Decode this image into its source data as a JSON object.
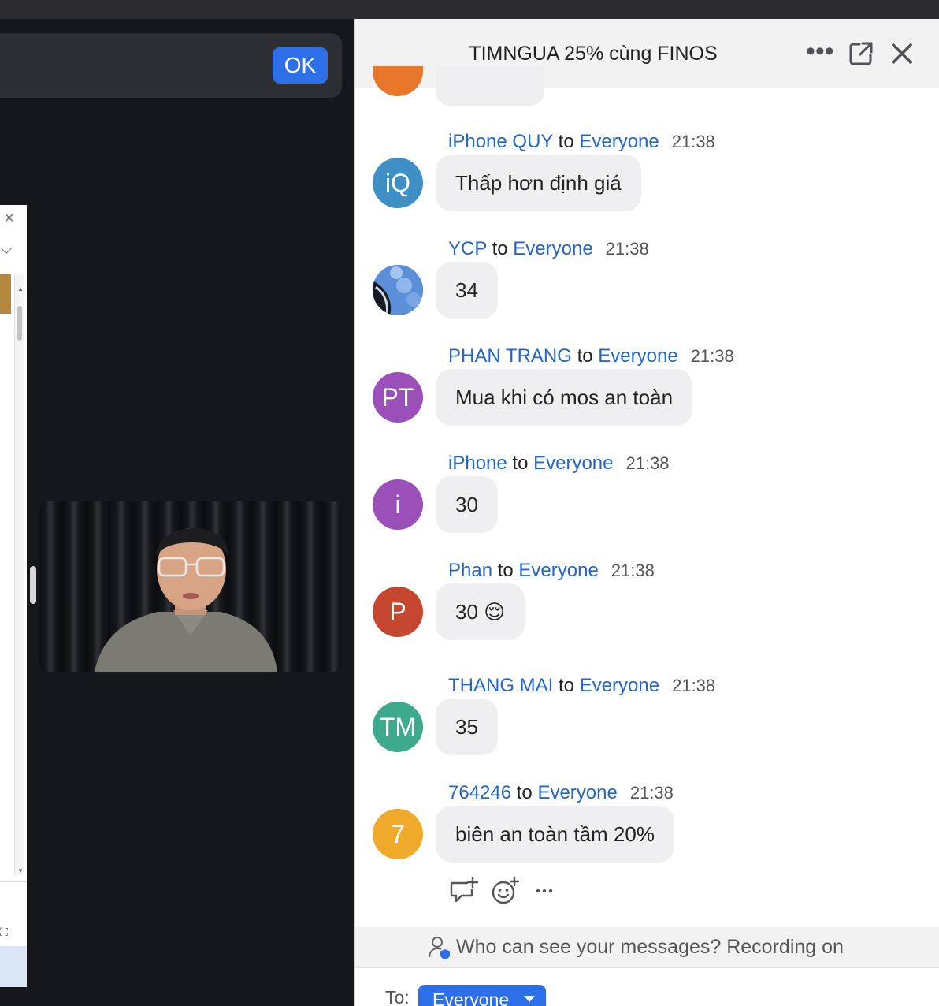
{
  "window": {
    "ok_label": "OK"
  },
  "chat": {
    "title": "TIMNGUA 25% cùng FINOS",
    "more_icon": "more-horizontal-icon",
    "popout_icon": "popout-icon",
    "close_icon": "close-icon",
    "to_word": "to",
    "messages": [
      {
        "sender": "iPhone QUY",
        "target": "Everyone",
        "time": "21:38",
        "text": "Thấp hơn định giá",
        "avatar_text": "iQ",
        "avatar_color": "#3d8fc4"
      },
      {
        "sender": "YCP",
        "target": "Everyone",
        "time": "21:38",
        "text": "34",
        "avatar_text": "",
        "avatar_color": "#1d3f7c"
      },
      {
        "sender": "PHAN TRANG",
        "target": "Everyone",
        "time": "21:38",
        "text": "Mua khi có mos an toàn",
        "avatar_text": "PT",
        "avatar_color": "#9b4fb8"
      },
      {
        "sender": "iPhone",
        "target": "Everyone",
        "time": "21:38",
        "text": "30",
        "avatar_text": "i",
        "avatar_color": "#9b4fb8"
      },
      {
        "sender": "Phan",
        "target": "Everyone",
        "time": "21:38",
        "text": "30 😌",
        "avatar_text": "P",
        "avatar_color": "#c5472f"
      },
      {
        "sender": "THANG MAI",
        "target": "Everyone",
        "time": "21:38",
        "text": "35",
        "avatar_text": "TM",
        "avatar_color": "#3daa8d"
      },
      {
        "sender": "764246",
        "target": "Everyone",
        "time": "21:38",
        "text": "biên an toàn tầm 20%",
        "avatar_text": "7",
        "avatar_color": "#efaa2b"
      }
    ],
    "notice": "Who can see your messages? Recording on",
    "to_label": "To:",
    "to_value": "Everyone"
  }
}
